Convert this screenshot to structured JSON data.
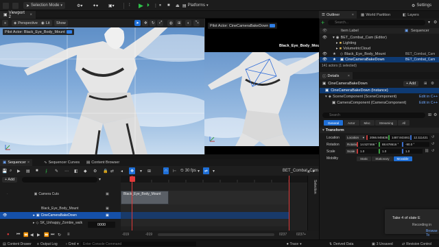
{
  "toolbar": {
    "selection_mode": "Selection Mode",
    "platforms": "Platforms",
    "settings": "Settings"
  },
  "viewport": {
    "tab_title": "Viewport 2",
    "perspective": "Perspective",
    "lit": "Lit",
    "show": "Show",
    "pilot_actor_1": "Pilot Actor: Black_Eye_Body_Mount",
    "pilot_actor_2": "Pilot Actor: CineCameraBakeDown",
    "overlay_label": "Black_Eye_Body_Mount"
  },
  "outliner": {
    "tabs": [
      "Outliner",
      "World Partition",
      "Layers"
    ],
    "search_placeholder": "Search...",
    "col_item": "Item Label",
    "col_type": "Sequencer",
    "rows": [
      {
        "label": "BET_Combat_Cam (Editor)",
        "type": ""
      },
      {
        "label": "Lighting",
        "type": ""
      },
      {
        "label": "VolumetricCloud",
        "type": ""
      },
      {
        "label": "Black_Eye_Body_Mount",
        "type": "BET_Combat_Cam"
      },
      {
        "label": "CineCameraBakeDown",
        "type": "BET_Combat_Cam"
      }
    ],
    "count": "141 actors (1 selected)"
  },
  "details": {
    "tab": "Details",
    "actor_name": "CineCameraBakeDown",
    "add": "+ Add",
    "instance": "CineCameraBakeDown (Instance)",
    "scene_component": "SceneComponent (SceneComponent)",
    "camera_component": "CameraComponent (CameraComponent)",
    "edit_cpp": "Edit in C++",
    "search_placeholder": "Search",
    "filters": [
      "General",
      "Actor",
      "Misc",
      "Streaming",
      "All"
    ],
    "transform_header": "Transform",
    "location_label": "Location",
    "rotation_label": "Rotation",
    "scale_label": "Scale",
    "mobility_label": "Mobility",
    "location": [
      "2066.945636",
      "1487.843461",
      "12.111421"
    ],
    "rotation": [
      "14.527466 °",
      "88.678616 °",
      "-90.0 °"
    ],
    "scale": [
      "1.0",
      "1.0",
      "1.0"
    ],
    "mobility": [
      "Static",
      "Stationary",
      "Movable"
    ]
  },
  "sequencer": {
    "tabs": [
      "Sequencer",
      "Sequencer Curves",
      "Content Browser"
    ],
    "add": "+ Add",
    "fps": "30 fps",
    "sequence_name": "BET_Combat_Cam",
    "current_frame": "0000",
    "side_label": "Selection",
    "tracks": [
      "Camera Cuts",
      "Black_Eye_Body_Mount",
      "CineCameraBakeDown",
      "SK_Unhappy_Zombie_walk"
    ],
    "clip_label": "Black_Eye_Body_Mount",
    "ruler_left": "-019",
    "ruler_left2": "-019",
    "ruler_right": "0237",
    "ruler_right2": "0237+"
  },
  "statusbar": {
    "content_drawer": "Content Drawer",
    "output_log": "Output Log",
    "cmd": "Cmd",
    "console_placeholder": "Enter Console Command",
    "trace": "Trace",
    "derived_data": "Derived Data",
    "unsaved": "3 Unsaved",
    "revision": "Revision Control"
  },
  "toast": {
    "title": "Take 4 of slate E",
    "line2": "Recording in",
    "browse": "Browse To",
    "stop": "Stop"
  }
}
